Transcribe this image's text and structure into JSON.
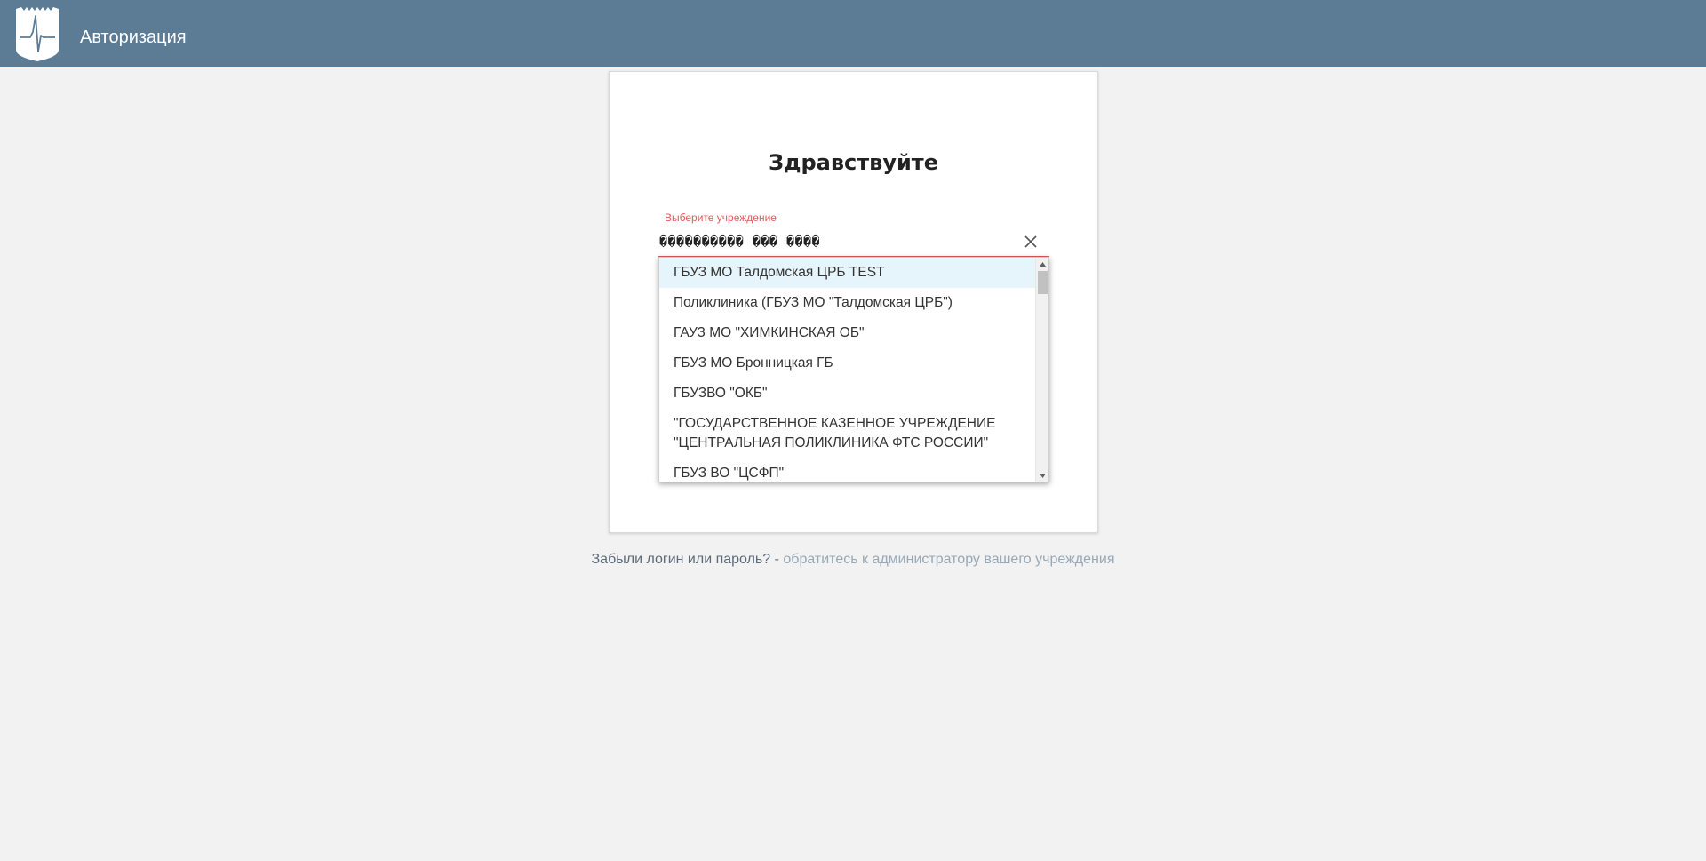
{
  "header": {
    "title": "Авторизация",
    "logo_icon": "heartbeat-shield-logo",
    "bg_color": "#5c7b95"
  },
  "login": {
    "greeting": "Здравствуйте",
    "institution_label": "Выберите учреждение",
    "institution_value": "���������� ��� ����",
    "clear_icon": "close-icon",
    "label_color": "#e05a5a",
    "options": [
      "ГБУЗ МО Талдомская ЦРБ TEST",
      "Поликлиника (ГБУЗ МО \"Талдомская ЦРБ\")",
      "ГАУЗ МО \"ХИМКИНСКАЯ ОБ\"",
      "ГБУЗ МО Бронницкая ГБ",
      "ГБУЗВО \"ОКБ\"",
      "\"ГОСУДАРСТВЕННОЕ КАЗЕННОЕ УЧРЕЖДЕНИЕ \"ЦЕНТРАЛЬНАЯ ПОЛИКЛИНИКА ФТС РОССИИ\"",
      "ГБУЗ ВО \"ЦСФП\""
    ],
    "highlighted_index": 0
  },
  "footer": {
    "question": "Забыли логин или пароль? - ",
    "link_text": "обратитесь к администратору вашего учреждения"
  }
}
